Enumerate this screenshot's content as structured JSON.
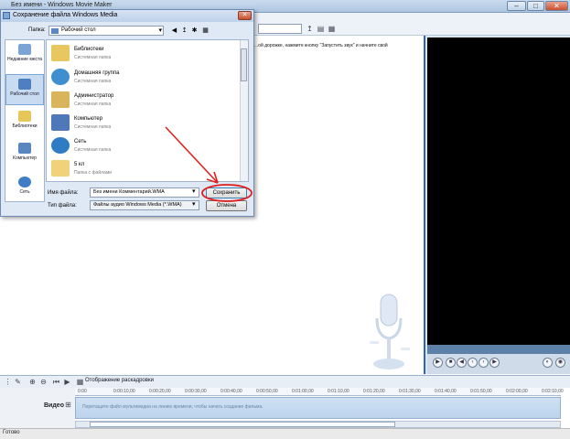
{
  "main_window": {
    "title": "Без имени - Windows Movie Maker",
    "controls": {
      "minimize": "–",
      "maximize": "□",
      "close": "✕"
    }
  },
  "tasks_hint": "...ой дорожке, нажмите кнопку \"Запустить звук\" и начните свой",
  "dialog": {
    "title": "Сохранение файла Windows Media",
    "close_label": "✕",
    "look_in_label": "Папка:",
    "look_in_value": "Рабочий стол",
    "places": [
      {
        "label": "Недавние места",
        "icon": "recent-places-icon"
      },
      {
        "label": "Рабочий стол",
        "icon": "desktop-icon"
      },
      {
        "label": "Библиотеки",
        "icon": "libraries-icon"
      },
      {
        "label": "Компьютер",
        "icon": "computer-icon"
      },
      {
        "label": "Сеть",
        "icon": "network-icon"
      }
    ],
    "items": [
      {
        "name": "Библиотеки",
        "desc": "Системная папка",
        "icon": "libraries-folder-icon"
      },
      {
        "name": "Домашняя группа",
        "desc": "Системная папка",
        "icon": "homegroup-icon"
      },
      {
        "name": "Администратор",
        "desc": "Системная папка",
        "icon": "user-folder-icon"
      },
      {
        "name": "Компьютер",
        "desc": "Системная папка",
        "icon": "computer-icon"
      },
      {
        "name": "Сеть",
        "desc": "Системная папка",
        "icon": "network-icon"
      },
      {
        "name": "5 кл",
        "desc": "Папка с файлами",
        "icon": "folder-icon"
      }
    ],
    "filename_label": "Имя файла:",
    "filename_value": "Без имени Комментарий.WMA",
    "filetype_label": "Тип файла:",
    "filetype_value": "Файлы аудио Windows Media (*.WMA)",
    "save_button": "Сохранить",
    "cancel_button": "Отмена"
  },
  "timeline": {
    "view_label": "Отображение раскадровки",
    "ticks": [
      "0:00",
      "0:00:10,00",
      "0:00:20,00",
      "0:00:30,00",
      "0:00:40,00",
      "0:00:50,00",
      "0:01:00,00",
      "0:01:10,00",
      "0:01:20,00",
      "0:01:30,00",
      "0:01:40,00",
      "0:01:50,00",
      "0:02:00,00",
      "0:02:10,00"
    ],
    "video_track_label": "Видео",
    "track_hint": "Перетащите файл мультимедиа на линию времени, чтобы начать создание фильма."
  },
  "status": "Готово",
  "colors": {
    "annotation_red": "#e02020",
    "preview_border": "#2f63b4"
  }
}
